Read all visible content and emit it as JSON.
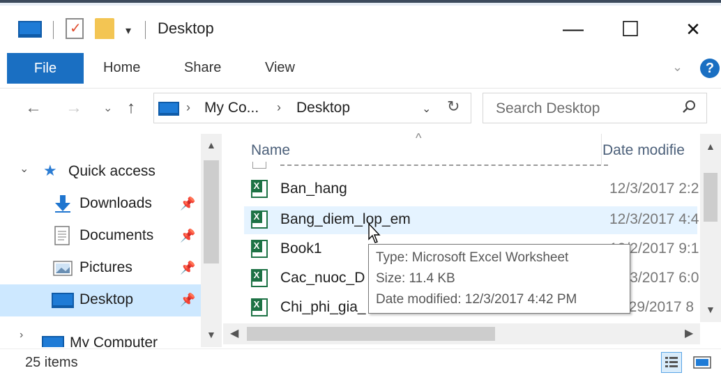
{
  "window": {
    "title": "Desktop",
    "minimize_glyph": "—",
    "maximize_glyph": "☐",
    "close_glyph": "✕"
  },
  "quick_access_toolbar": {
    "icons": [
      "computer-icon",
      "properties-icon",
      "new-folder-icon"
    ],
    "dropdown_glyph": "▾"
  },
  "ribbon": {
    "tabs": [
      {
        "label": "File",
        "active": true
      },
      {
        "label": "Home"
      },
      {
        "label": "Share"
      },
      {
        "label": "View"
      }
    ],
    "expand_glyph": "⌄",
    "help_glyph": "?"
  },
  "address_bar": {
    "breadcrumbs": [
      "My Co...",
      "Desktop"
    ],
    "separator": "›",
    "dropdown_glyph": "⌄",
    "refresh_glyph": "↻"
  },
  "search": {
    "placeholder": "Search Desktop"
  },
  "nav_glyphs": {
    "back": "←",
    "forward": "→",
    "recent": "⌄",
    "up": "↑"
  },
  "navigation_pane": {
    "quick_access_label": "Quick access",
    "items": [
      {
        "label": "Downloads",
        "pinned": true
      },
      {
        "label": "Documents",
        "pinned": true
      },
      {
        "label": "Pictures",
        "pinned": true
      },
      {
        "label": "Desktop",
        "pinned": true,
        "selected": true
      }
    ],
    "partial_item_label": "My Computer"
  },
  "file_list": {
    "columns": {
      "name": "Name",
      "date": "Date modifie"
    },
    "rows": [
      {
        "name": "Ban_hang",
        "date": "12/3/2017 2:2"
      },
      {
        "name": "Bang_diem_lop_em",
        "date": "12/3/2017 4:4",
        "hover": true
      },
      {
        "name": "Book1",
        "date": "12/2/2017 9:1"
      },
      {
        "name": "Cac_nuoc_D",
        "date": "12/3/2017 6:0"
      },
      {
        "name": "Chi_phi_gia_",
        "date": "11/29/2017 8"
      }
    ]
  },
  "tooltip": {
    "type_line": "Type: Microsoft Excel Worksheet",
    "size_line": "Size: 11.4 KB",
    "date_line": "Date modified: 12/3/2017 4:42 PM"
  },
  "status_bar": {
    "item_count": "25 items"
  },
  "colors": {
    "accent": "#1a6fc2",
    "selection": "#cde8ff",
    "hover": "#e5f3ff",
    "excel_green": "#1d7245"
  }
}
